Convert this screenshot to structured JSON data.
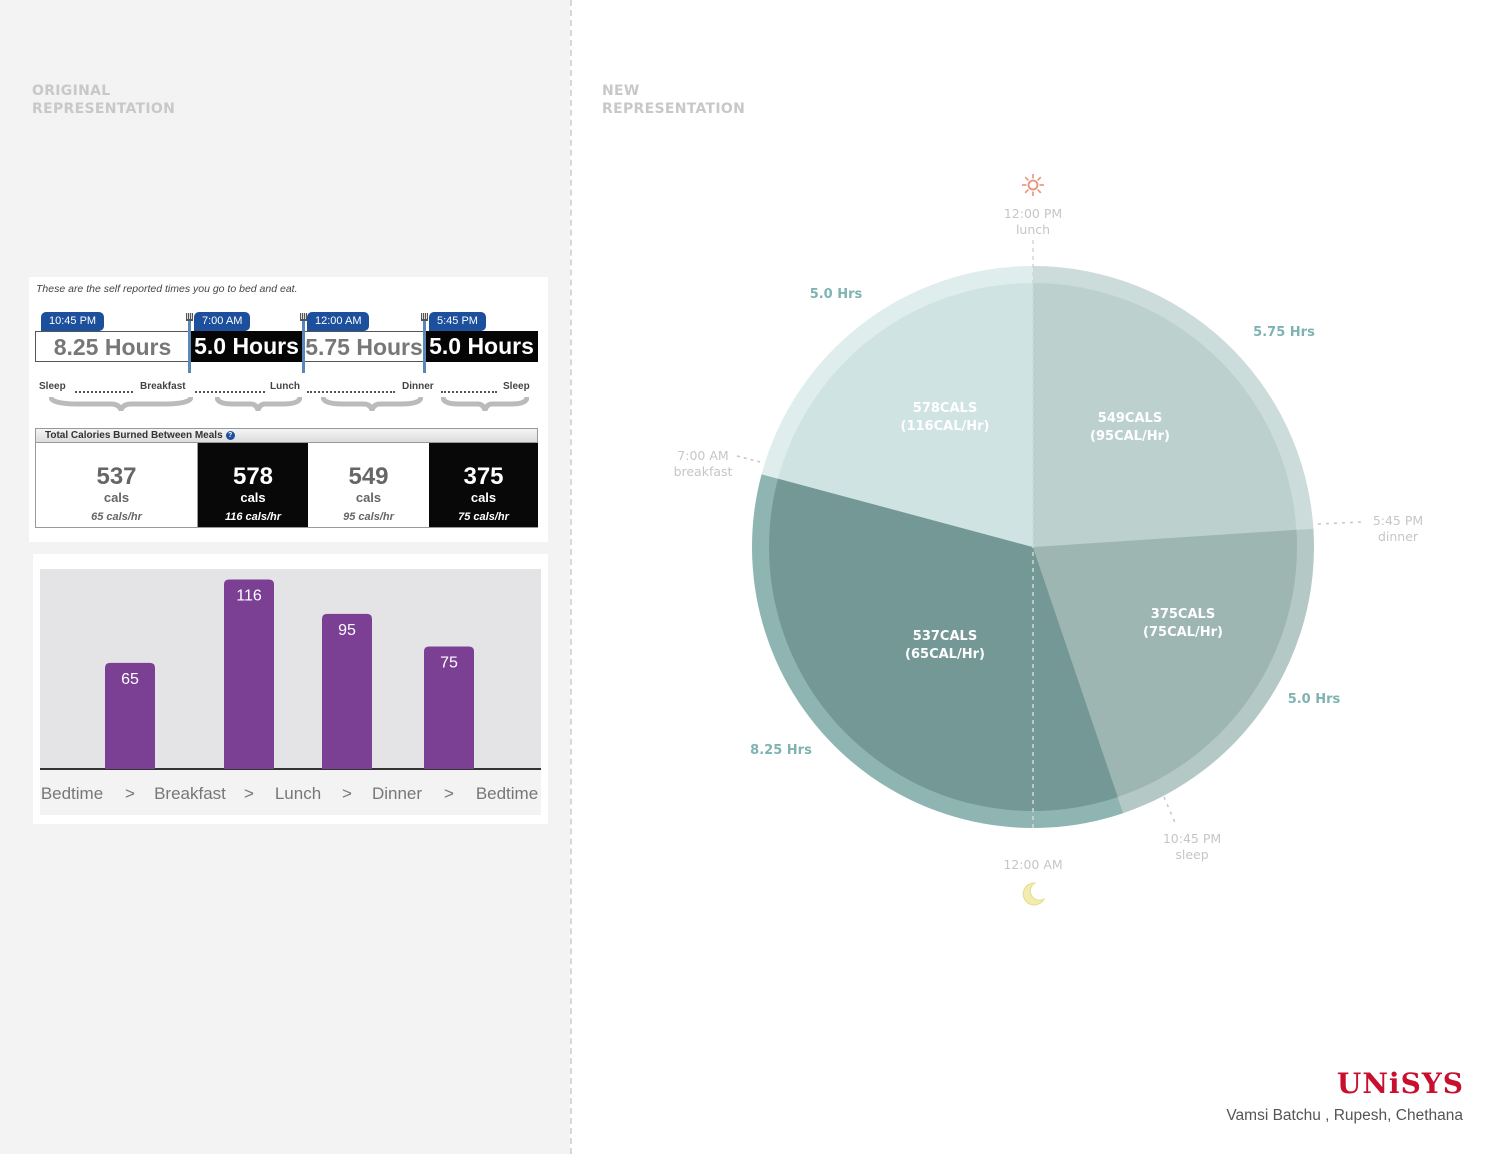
{
  "headings": {
    "original": [
      "ORIGINAL",
      "REPRESENTATION"
    ],
    "new": [
      "NEW",
      "REPRESENTATION"
    ]
  },
  "original_widget": {
    "intro": "These are the self reported times you go to bed and eat.",
    "time_flags": [
      "10:45 PM",
      "7:00 AM",
      "12:00 AM",
      "5:45 PM"
    ],
    "segments": [
      {
        "label": "8.25 Hours",
        "style": "light"
      },
      {
        "label": "5.0 Hours",
        "style": "dark"
      },
      {
        "label": "5.75 Hours",
        "style": "light"
      },
      {
        "label": "5.0 Hours",
        "style": "dark"
      }
    ],
    "meal_labels": [
      "Sleep",
      "Breakfast",
      "Lunch",
      "Dinner",
      "Sleep"
    ],
    "calories_header": "Total Calories Burned Between Meals",
    "info_icon": "?",
    "calorie_boxes": [
      {
        "value": "537",
        "unit": "cals",
        "rate": "65 cals/hr",
        "style": "light"
      },
      {
        "value": "578",
        "unit": "cals",
        "rate": "116 cals/hr",
        "style": "dark"
      },
      {
        "value": "549",
        "unit": "cals",
        "rate": "95 cals/hr",
        "style": "light"
      },
      {
        "value": "375",
        "unit": "cals",
        "rate": "75 cals/hr",
        "style": "dark"
      }
    ]
  },
  "chart_data": [
    {
      "type": "bar",
      "title": "",
      "categories": [
        "Bedtime",
        "Breakfast",
        "Lunch",
        "Dinner"
      ],
      "values": [
        65,
        116,
        95,
        75
      ],
      "x_tick_labels": [
        "Bedtime",
        ">",
        "Breakfast",
        ">",
        "Lunch",
        ">",
        "Dinner",
        ">",
        "Bedtime"
      ],
      "ylim": [
        0,
        120
      ],
      "bar_color": "#7b3f93",
      "background_color": "#e4e4e6",
      "data_labels": true,
      "grid": false
    },
    {
      "type": "pie",
      "title": "",
      "slices": [
        {
          "period": "Bedtime to Breakfast",
          "hours": 8.25,
          "duration_label": "8.25 Hrs",
          "cals_label": "537CALS",
          "rate_label": "(65CAL/Hr)",
          "calories": 537,
          "cal_per_hr": 65,
          "color": "#739895"
        },
        {
          "period": "Breakfast to Lunch",
          "hours": 5.0,
          "duration_label": "5.0 Hrs",
          "cals_label": "578CALS",
          "rate_label": "(116CAL/Hr)",
          "calories": 578,
          "cal_per_hr": 116,
          "color": "#cfe3e2"
        },
        {
          "period": "Lunch to Dinner",
          "hours": 5.75,
          "duration_label": "5.75 Hrs",
          "cals_label": "549CALS",
          "rate_label": "(95CAL/Hr)",
          "calories": 549,
          "cal_per_hr": 95,
          "color": "#bcd1cd"
        },
        {
          "period": "Dinner to Bedtime",
          "hours": 5.0,
          "duration_label": "5.0 Hrs",
          "cals_label": "375CALS",
          "rate_label": "(75CAL/Hr)",
          "calories": 375,
          "cal_per_hr": 75,
          "color": "#9db6b2"
        }
      ],
      "clock_labels": [
        {
          "time": "12:00 PM",
          "event": "lunch"
        },
        {
          "time": "7:00 AM",
          "event": "breakfast"
        },
        {
          "time": "5:45 PM",
          "event": "dinner"
        },
        {
          "time": "10:45 PM",
          "event": "sleep"
        },
        {
          "time": "12:00 AM",
          "event": ""
        }
      ],
      "icons": [
        "sun-icon",
        "moon-icon"
      ],
      "label_color": "#7fb3b3",
      "clock_label_color": "#c6c6c6"
    }
  ],
  "footer": {
    "logo": "UNiSYS",
    "credits": "Vamsi Batchu , Rupesh, Chethana"
  }
}
